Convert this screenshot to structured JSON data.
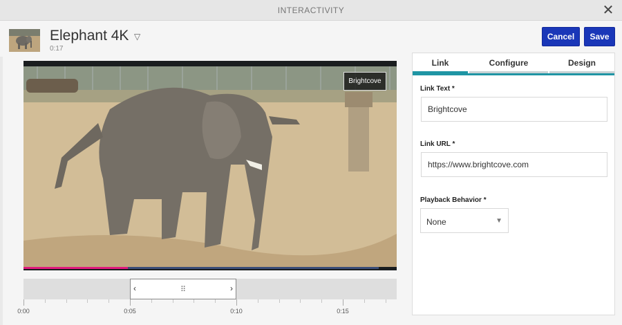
{
  "window": {
    "title": "INTERACTIVITY",
    "close_icon": "close-icon"
  },
  "video": {
    "title": "Elephant 4K",
    "duration": "0:17",
    "title_menu_icon": "caret-down-icon"
  },
  "actions": {
    "cancel_label": "Cancel",
    "save_label": "Save"
  },
  "player": {
    "overlay_link_text": "Brightcove",
    "progress_fraction": 0.28,
    "progress_color": "#e0197d"
  },
  "timeline": {
    "ticks": [
      "0:00",
      "0:05",
      "0:10",
      "0:15"
    ],
    "selection_start_seconds": 5,
    "selection_end_seconds": 10,
    "grip_icon": "drag-grip-icon"
  },
  "panel": {
    "tabs": [
      {
        "label": "Link",
        "active": true
      },
      {
        "label": "Configure",
        "active": false
      },
      {
        "label": "Design",
        "active": false
      }
    ],
    "link_text": {
      "label": "Link Text *",
      "value": "Brightcove"
    },
    "link_url": {
      "label": "Link URL *",
      "value": "https://www.brightcove.com"
    },
    "playback": {
      "label": "Playback Behavior *",
      "selected": "None"
    }
  },
  "colors": {
    "accent": "#1a37b8",
    "tab_accent": "#1f95a4"
  }
}
